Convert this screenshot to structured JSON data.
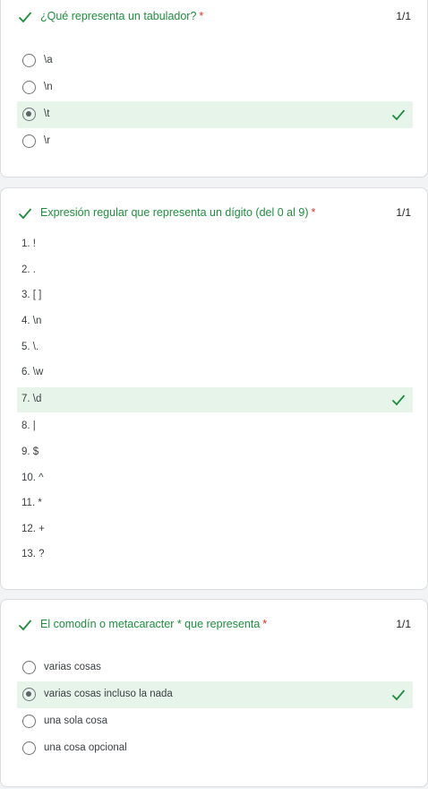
{
  "colors": {
    "correct": "#1e8e3e",
    "required": "#d93025",
    "highlight": "#e6f4ea"
  },
  "q1": {
    "title": "¿Qué representa un tabulador?",
    "required": "*",
    "score": "1/1",
    "options": [
      {
        "label": "\\a",
        "selected": false,
        "correct": false
      },
      {
        "label": "\\n",
        "selected": false,
        "correct": false
      },
      {
        "label": "\\t",
        "selected": true,
        "correct": true
      },
      {
        "label": "\\r",
        "selected": false,
        "correct": false
      }
    ]
  },
  "q2": {
    "title": "Expresión regular que representa un dígito (del 0 al 9)",
    "required": "*",
    "score": "1/1",
    "items": [
      {
        "label": "1. !",
        "correct": false
      },
      {
        "label": "2. .",
        "correct": false
      },
      {
        "label": "3. [ ]",
        "correct": false
      },
      {
        "label": "4. \\n",
        "correct": false
      },
      {
        "label": "5. \\.",
        "correct": false
      },
      {
        "label": "6. \\w",
        "correct": false
      },
      {
        "label": "7. \\d",
        "correct": true
      },
      {
        "label": "8. |",
        "correct": false
      },
      {
        "label": "9. $",
        "correct": false
      },
      {
        "label": "10. ^",
        "correct": false
      },
      {
        "label": "11. *",
        "correct": false
      },
      {
        "label": "12. +",
        "correct": false
      },
      {
        "label": "13. ?",
        "correct": false
      }
    ]
  },
  "q3": {
    "title": "El comodín o metacaracter * que representa",
    "required": "*",
    "score": "1/1",
    "options": [
      {
        "label": "varias cosas",
        "selected": false,
        "correct": false
      },
      {
        "label": "varias cosas incluso la nada",
        "selected": true,
        "correct": true
      },
      {
        "label": "una sola cosa",
        "selected": false,
        "correct": false
      },
      {
        "label": "una cosa opcional",
        "selected": false,
        "correct": false
      }
    ]
  }
}
